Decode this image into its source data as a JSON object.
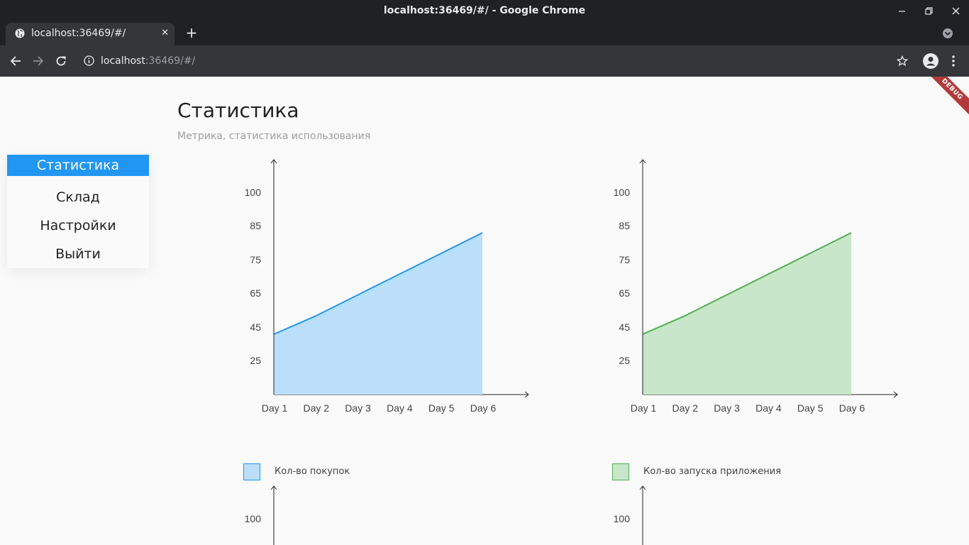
{
  "window": {
    "title": "localhost:36469/#/ - Google Chrome",
    "minimize_icon": "minimize-icon",
    "restore_icon": "restore-icon",
    "close_icon": "close-icon"
  },
  "tab": {
    "title": "localhost:36469/#/",
    "favicon": "globe-icon",
    "close": "✕"
  },
  "toolbar": {
    "url_host": "localhost",
    "url_rest": ":36469/#/"
  },
  "app": {
    "debug_banner": "DEBUG",
    "page_title": "Статистика",
    "page_subtitle": "Метрика, статистика использования",
    "menu": [
      {
        "label": "Статистика",
        "active": true
      },
      {
        "label": "Склад",
        "active": false
      },
      {
        "label": "Настройки",
        "active": false
      },
      {
        "label": "Выйти",
        "active": false
      }
    ]
  },
  "chart_data": [
    {
      "type": "area",
      "categories": [
        "Day 1",
        "Day 2",
        "Day 3",
        "Day 4",
        "Day 5",
        "Day 6"
      ],
      "y_ticks": [
        "100",
        "85",
        "75",
        "65",
        "45",
        "25"
      ],
      "series": [
        {
          "name": "Кол-во покупок",
          "values": [
            45,
            52,
            60,
            68,
            76,
            84
          ],
          "color": "#2196f3",
          "fill": "#bbdefb"
        }
      ]
    },
    {
      "type": "area",
      "categories": [
        "Day 1",
        "Day 2",
        "Day 3",
        "Day 4",
        "Day 5",
        "Day 6"
      ],
      "y_ticks": [
        "100",
        "85",
        "75",
        "65",
        "45",
        "25"
      ],
      "series": [
        {
          "name": "Кол-во запуска приложения",
          "values": [
            45,
            52,
            60,
            68,
            76,
            84
          ],
          "color": "#4caf50",
          "fill": "#c8e6c9"
        }
      ]
    },
    {
      "type": "area",
      "categories": [],
      "y_ticks": [
        "100"
      ],
      "series": []
    },
    {
      "type": "area",
      "categories": [],
      "y_ticks": [
        "100"
      ],
      "series": []
    }
  ]
}
